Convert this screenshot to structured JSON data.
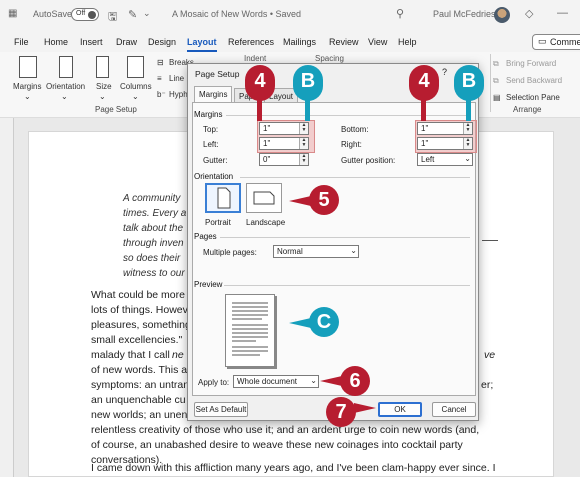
{
  "titlebar": {
    "autosave": "AutoSave",
    "toggle": "Off",
    "doc_title": "A Mosaic of New Words • Saved",
    "search_icon": "search-icon",
    "user": "Paul McFedries",
    "controls": [
      "minimize-icon",
      "restore-icon",
      "close-icon"
    ]
  },
  "menu": {
    "tabs": [
      "File",
      "Home",
      "Insert",
      "Draw",
      "Design",
      "Layout",
      "References",
      "Mailings",
      "Review",
      "View",
      "Help"
    ],
    "active": "Layout",
    "comments": "Commen"
  },
  "ribbon": {
    "margins": "Margins",
    "orientation": "Orientation",
    "size": "Size",
    "columns": "Columns",
    "breaks": "Breaks",
    "line": "Line",
    "hyph": "Hyph",
    "indent": "Indent",
    "spacing": "Spacing",
    "bring_forward": "Bring Forward",
    "send_backward": "Send Backward",
    "selection_pane": "Selection Pane",
    "group_page_setup": "Page Setup",
    "group_arrange": "Arrange"
  },
  "document": {
    "quote_lines": [
      "A community",
      "times. Every a",
      "talk about the",
      "through inven",
      "so does their",
      "witness to our"
    ],
    "body_lines": [
      "What could be more",
      "lots of things. Howev",
      "pleasures, something",
      "small excellencies.\"",
      "malady that I call ",
      "of new words. This a",
      "symptoms: an untran",
      "an unquenchable cu",
      "new worlds; an unen",
      "relentless creativity of those who use it; and an ardent urge to coin new words (and,",
      "of course, an unabashed desire to weave these new coinages into cocktail party",
      "conversations).",
      "I came down with this affliction many years ago, and I've been clam-happy ever since. I"
    ],
    "body_right_fragments": [
      "ve",
      "er;"
    ]
  },
  "dialog": {
    "title": "Page Setup",
    "help": "?",
    "close": "×",
    "tabs": [
      "Margins",
      "Paper",
      "Layout"
    ],
    "margins_section": "Margins",
    "top_label": "Top:",
    "top_value": "1\"",
    "left_label": "Left:",
    "left_value": "1\"",
    "gutter_label": "Gutter:",
    "gutter_value": "0\"",
    "bottom_label": "Bottom:",
    "bottom_value": "1\"",
    "right_label": "Right:",
    "right_value": "1\"",
    "gutter_pos_label": "Gutter position:",
    "gutter_pos_value": "Left",
    "orientation_section": "Orientation",
    "portrait": "Portrait",
    "landscape": "Landscape",
    "pages_section": "Pages",
    "multiple_pages_label": "Multiple pages:",
    "multiple_pages_value": "Normal",
    "preview_section": "Preview",
    "apply_to_label": "Apply to:",
    "apply_to_value": "Whole document",
    "set_default": "Set As Default",
    "ok": "OK",
    "cancel": "Cancel"
  },
  "callouts": {
    "four_a": "4",
    "b_a": "B",
    "four_b": "4",
    "b_b": "B",
    "five": "5",
    "c": "C",
    "six": "6",
    "seven": "7",
    "red_color": "#b71d30",
    "teal_color": "#159fbc"
  }
}
